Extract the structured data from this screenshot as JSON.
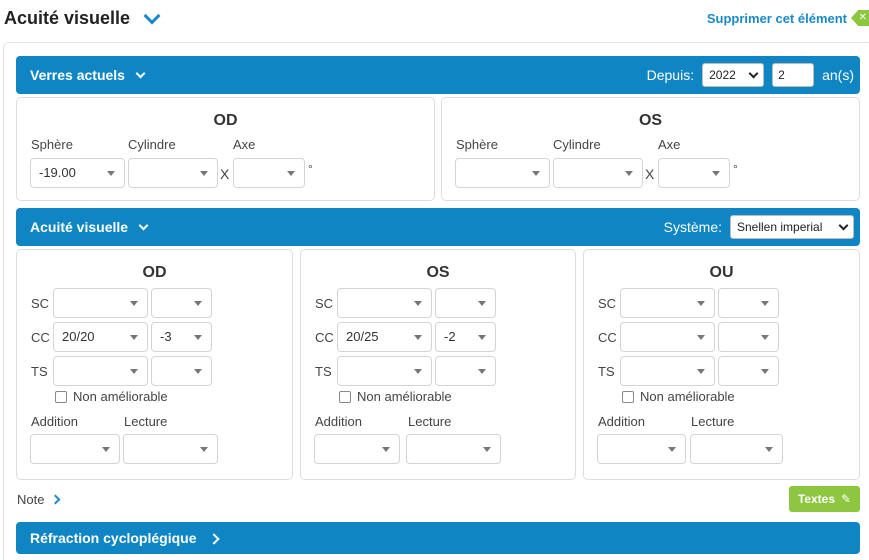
{
  "header": {
    "title": "Acuité visuelle",
    "delete_label": "Supprimer cet élément"
  },
  "verres": {
    "title": "Verres actuels",
    "depuis_label": "Depuis:",
    "year": "2022",
    "years_count": "2",
    "years_unit": "an(s)",
    "od": {
      "title": "OD",
      "sphere_label": "Sphère",
      "cyl_label": "Cylindre",
      "axe_label": "Axe",
      "sphere": "-19.00",
      "cyl": "",
      "axe": ""
    },
    "os": {
      "title": "OS",
      "sphere_label": "Sphère",
      "cyl_label": "Cylindre",
      "axe_label": "Axe",
      "sphere": "",
      "cyl": "",
      "axe": ""
    },
    "x": "X",
    "deg": "°"
  },
  "acuite": {
    "title": "Acuité visuelle",
    "systeme_label": "Système:",
    "systeme": "Snellen imperial",
    "labels": {
      "sc": "SC",
      "cc": "CC",
      "ts": "TS",
      "non_amel": "Non améliorable",
      "addition": "Addition",
      "lecture": "Lecture"
    },
    "od": {
      "title": "OD",
      "sc1": "",
      "sc2": "",
      "cc1": "20/20",
      "cc2": "-3",
      "ts1": "",
      "ts2": ""
    },
    "os": {
      "title": "OS",
      "sc1": "",
      "sc2": "",
      "cc1": "20/25",
      "cc2": "-2",
      "ts1": "",
      "ts2": ""
    },
    "ou": {
      "title": "OU",
      "sc1": "",
      "sc2": "",
      "cc1": "",
      "cc2": "",
      "ts1": "",
      "ts2": ""
    }
  },
  "note_label": "Note",
  "textes_label": "Textes",
  "refraction": {
    "title": "Réfraction cycloplégique"
  }
}
